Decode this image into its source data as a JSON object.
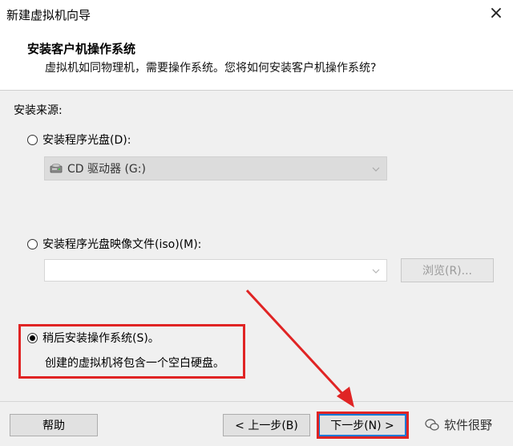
{
  "window": {
    "title": "新建虚拟机向导",
    "close_glyph": "×"
  },
  "header": {
    "heading": "安装客户机操作系统",
    "subheading": "虚拟机如同物理机，需要操作系统。您将如何安装客户机操作系统?"
  },
  "source": {
    "label": "安装来源:",
    "options": [
      {
        "label": "安装程序光盘(D):",
        "checked": false
      },
      {
        "label": "安装程序光盘映像文件(iso)(M):",
        "checked": false
      },
      {
        "label": "稍后安装操作系统(S)。",
        "checked": true
      }
    ],
    "cd_combo_value": "CD 驱动器 (G:)",
    "iso_value": "",
    "browse_label": "浏览(R)...",
    "later_description": "创建的虚拟机将包含一个空白硬盘。"
  },
  "buttons": {
    "help": "帮助",
    "prev": "< 上一步(B)",
    "next": "下一步(N) >"
  },
  "watermark": {
    "text": "软件很野"
  },
  "colors": {
    "highlight_red": "#e02424",
    "accent_blue": "#0078d7"
  },
  "icons": {
    "close": "close-icon",
    "drive": "cd-drive-icon",
    "dropdown": "chevron-down-icon",
    "watermark": "wechat-icon"
  }
}
